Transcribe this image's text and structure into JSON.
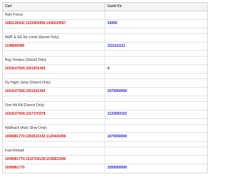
{
  "table": {
    "headers": {
      "cari": "Cari",
      "ganti_ke": "Ganti Ke"
    },
    "sections": [
      {
        "title": "Auto Focus",
        "rows": [
          {
            "address": "1082130432;1120403456;1045220557",
            "value": "15000"
          }
        ]
      },
      {
        "title": "AWP & SG No Limid (Dword Only)",
        "rows": [
          {
            "address": "1148846080",
            "value": "1111111111"
          }
        ]
      },
      {
        "title": "Bug Tembus (Dword Only)",
        "rows": [
          {
            "address": "1034147594;1051931443",
            "value": "4"
          }
        ]
      },
      {
        "title": "Fly Hight Jump (Dword Only)",
        "rows": [
          {
            "address": "1034147594;1051931443",
            "value": "1070000000"
          }
        ]
      },
      {
        "title": "One Hit Kill (Dword Only)",
        "rows": [
          {
            "address": "1034147594;1017370378",
            "value": "1132593152"
          }
        ]
      },
      {
        "title": "Wallhack (Auto Slow Only)",
        "rows": [
          {
            "address": "1008981770;1092616192;1120403456",
            "value": "1070000000"
          }
        ]
      },
      {
        "title": "Fast Reload",
        "rows": [
          {
            "address": "1008981770;1110704128;1036831949",
            "value": ""
          },
          {
            "address": "1008981770",
            "value": "1055000000"
          }
        ]
      }
    ]
  },
  "colors": {
    "address_red": "#d21414",
    "value_blue": "#1a1ad6"
  }
}
